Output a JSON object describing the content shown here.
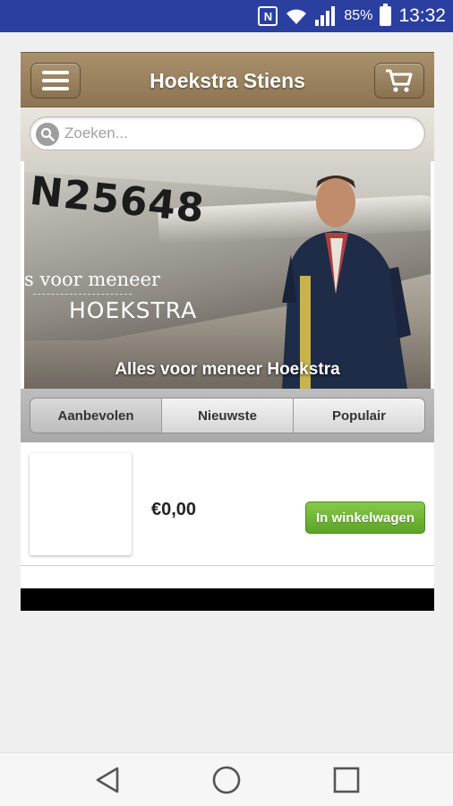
{
  "status_bar": {
    "battery_percent": "85%",
    "time": "13:32",
    "icons": [
      "nfc-icon",
      "wifi-icon",
      "signal-icon",
      "battery-icon"
    ]
  },
  "header": {
    "title": "Hoekstra Stiens",
    "menu_icon": "hamburger-menu-icon",
    "cart_icon": "shopping-cart-icon"
  },
  "search": {
    "placeholder": "Zoeken...",
    "value": "",
    "icon": "search-icon"
  },
  "banner": {
    "image_text_reg": "N25648",
    "image_text_tagline": "s voor meneer",
    "image_text_brand": "HOEKSTRA",
    "caption": "Alles voor meneer Hoekstra"
  },
  "tabs": [
    {
      "label": "Aanbevolen",
      "active": true
    },
    {
      "label": "Nieuwste",
      "active": false
    },
    {
      "label": "Populair",
      "active": false
    }
  ],
  "products": [
    {
      "price": "€0,00",
      "add_label": "In winkelwagen"
    }
  ],
  "colors": {
    "status_bar": "#2b3fa0",
    "header": "#9a8260",
    "add_button": "#6bb22f"
  },
  "navigation": {
    "icons": [
      "back-icon",
      "home-icon",
      "recent-apps-icon"
    ]
  }
}
